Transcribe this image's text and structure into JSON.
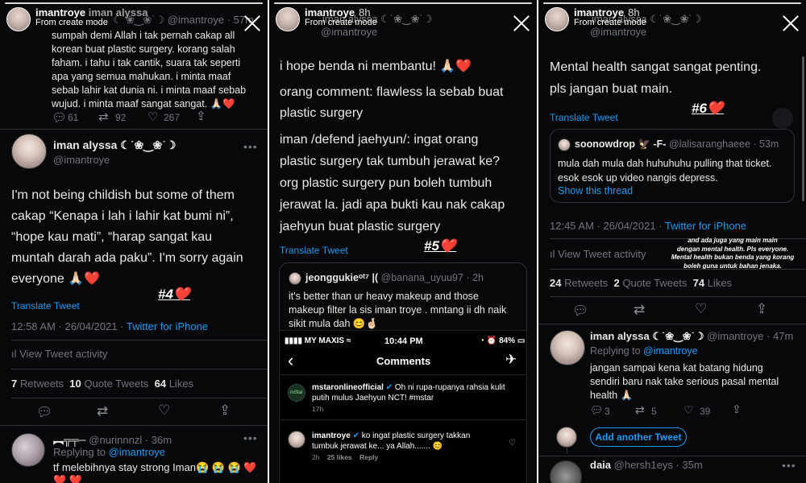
{
  "panel1": {
    "story_user": "imantroye",
    "story_overlap": "iman alyssa",
    "story_sub": "From create mode",
    "top_tweet": {
      "handle": "@imantroye",
      "time": "57m",
      "deco": "☾˙❀‿❀˙☽",
      "text": "sumpah demi Allah i tak pernah cakap all\nkorean buat plastic surgery. korang salah\nfaham. i tahu i tak cantik, suara tak seperti\napa yang semua mahukan. i minta maaf\nsebab lahir kat dunia ni. i minta maaf sebab\nwujud. i minta maaf sangat sangat. 🙏🏻❤️",
      "replies": "61",
      "retweets": "92",
      "likes": "267"
    },
    "main_tweet": {
      "name": "iman alyssa ☾˙❀‿❀˙☽",
      "handle": "@imantroye",
      "text": "I'm not being childish but some of them\ncakap “Kenapa i lah i lahir kat bumi ni”,\n“hope kau mati”, “harap sangat kau\nmuntah darah ada paku”. I'm sorry again\neveryone 🙏🏻❤️",
      "translate": "Translate Tweet",
      "badge": "#4❤️",
      "time": "12:58 AM · 26/04/2021",
      "source": "Twitter for iPhone",
      "activity": "View Tweet activity",
      "retweets_n": "7",
      "retweets_l": "Retweets",
      "quotes_n": "10",
      "quotes_l": "Quote Tweets",
      "likes_n": "64",
      "likes_l": "Likes"
    },
    "reply": {
      "name": "︻╦╤─",
      "handle": "@nurinnnzl",
      "time": "36m",
      "replying_to": "Replying to",
      "replying_handle": "@imantroye",
      "text": "tf melebihnya stay strong Iman😭 😭 😭 ❤️\n❤️ ❤️"
    }
  },
  "panel2": {
    "story_user": "imantroye",
    "story_time": "8h",
    "story_overlap": "iman alyssa ☾˙❀‿❀˙☽",
    "story_sub": "From create mode",
    "handle": "@imantroye",
    "text1": "i hope benda ni membantu! 🙏🏻❤️",
    "text2": "orang comment: flawless la sebab buat\nplastic surgery",
    "text3": "iman /defend jaehyun/: ingat orang\nplastic surgery tak tumbuh jerawat ke?\norg plastic surgery pun boleh tumbuh\njerawat la. jadi apa bukti kau nak cakap\njaehyun buat plastic surgery",
    "translate": "Translate Tweet",
    "badge": "#5❤️",
    "quote": {
      "name": "jeonggukieᵒᵗ⁷ |(",
      "handle": "@banana_uyuu97",
      "time": "2h",
      "text": "it's better than ur heavy makeup and those\nmakeup filter la sis iman troye  . mntang ii dh naik\nsikit mula dah 😊🤞🏻"
    },
    "ig": {
      "carrier": "MY MAXIS",
      "clock": "10:44 PM",
      "battery": "84%",
      "title": "Comments",
      "c1_user": "mstaronlineofficial",
      "c1_text": "Oh ni rupa-rupanya rahsia kulit\nputih mulus Jaehyun NCT! #mstar",
      "c1_time": "17h",
      "c2_user": "imantroye",
      "c2_text": "ko ingat plastic surgery takkan\ntumbuk jerawat ke... ya Allah....... 😊",
      "c2_time": "2h",
      "c2_likes": "25 likes",
      "c2_reply": "Reply",
      "avatar_label": "mStar"
    }
  },
  "panel3": {
    "story_user": "imantroye",
    "story_time": "8h",
    "story_overlap": "iman alyssa ☾˙❀‿❀˙☽",
    "story_sub": "From create mode",
    "handle": "@imantroye",
    "text": "Mental health sangat sangat penting.\npls jangan buat main.",
    "translate": "Translate Tweet",
    "badge": "#6❤️",
    "quote": {
      "name": "soonowdrop 🦅 -F-",
      "handle": "@lalisaranghaeee",
      "time": "53m",
      "text": "mula dah mula dah huhuhuhu pulling that ticket.\nesok esok up video nangis depress.",
      "show": "Show this thread"
    },
    "time": "12:45 AM · 26/04/2021",
    "source": "Twitter for iPhone",
    "activity": "View Tweet activity",
    "caption": "and ada juga yang main main\ndengan mental health. Pls everyone.\nMental health bukan benda yang korang\nboleh guna untuk bahan jenaka.",
    "retweets_n": "24",
    "retweets_l": "Retweets",
    "quotes_n": "2",
    "quotes_l": "Quote Tweets",
    "likes_n": "74",
    "likes_l": "Likes",
    "reply": {
      "name": "iman alyssa ☾˙❀‿❀˙☽",
      "handle": "@imantroye",
      "time": "47m",
      "replying_to": "Replying to",
      "replying_handle": "@imantroye",
      "text": "jangan sampai kena kat batang hidung\nsendiri baru nak take serious pasal mental\nhealth 🙏🏻",
      "replies": "3",
      "retweets": "5",
      "likes": "39"
    },
    "add_tweet": "Add another Tweet",
    "next": {
      "name": "daia",
      "handle": "@hersh1eys",
      "time": "35m"
    }
  }
}
